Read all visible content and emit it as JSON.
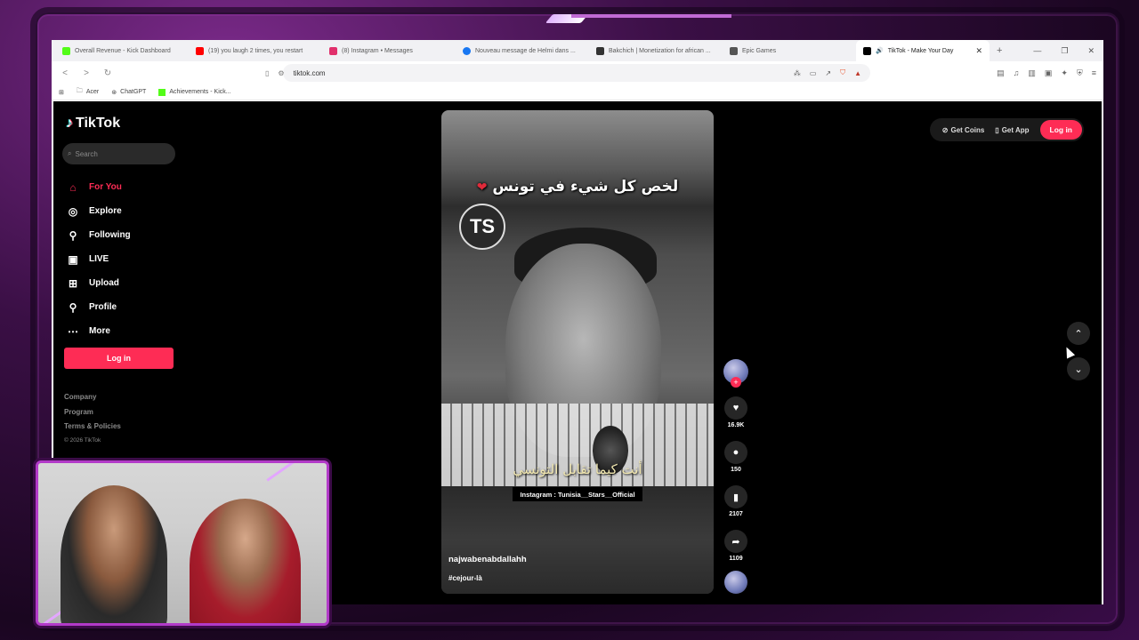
{
  "browser": {
    "tabs": [
      {
        "label": "Overall Revenue - Kick Dashboard",
        "color": "#53fc18"
      },
      {
        "label": "(19) you laugh 2 times, you restart",
        "color": "#ff0000"
      },
      {
        "label": "(8) Instagram • Messages",
        "color": "#e1306c"
      },
      {
        "label": "Nouveau message de Helmi dans ...",
        "color": "#1877f2"
      },
      {
        "label": "Bakchich | Monetization for african ...",
        "color": "#333333"
      },
      {
        "label": "Epic Games",
        "color": "#555555"
      },
      {
        "label": "TikTok - Make Your Day",
        "color": "#000000",
        "active": true
      }
    ],
    "url": "tiktok.com",
    "bookmarks": [
      "Acer",
      "ChatGPT",
      "Achievements - Kick..."
    ]
  },
  "tiktok": {
    "logo": "TikTok",
    "search_placeholder": "Search",
    "nav": [
      {
        "label": "For You",
        "icon": "home-icon",
        "glyph": "⌂",
        "active": true
      },
      {
        "label": "Explore",
        "icon": "compass-icon",
        "glyph": "◎"
      },
      {
        "label": "Following",
        "icon": "following-icon",
        "glyph": "⚲"
      },
      {
        "label": "LIVE",
        "icon": "live-icon",
        "glyph": "▣"
      },
      {
        "label": "Upload",
        "icon": "upload-icon",
        "glyph": "⊞"
      },
      {
        "label": "Profile",
        "icon": "profile-icon",
        "glyph": "⚲"
      },
      {
        "label": "More",
        "icon": "more-icon",
        "glyph": "⋯"
      }
    ],
    "login_label": "Log in",
    "footer": [
      "Company",
      "Program",
      "Terms & Policies"
    ],
    "copyright": "© 2026 TikTok",
    "get_coins": "Get Coins",
    "get_app": "Get App",
    "video": {
      "caption": "لخص كل شيء في تونس",
      "subtitle": "أنت كيما تقابل التونسي",
      "instagram": "Instagram : Tunisia__Stars__Official",
      "badge": "TS",
      "username": "najwabenabdallahh",
      "hashtag": "#cejour-là"
    },
    "actions": {
      "likes": "16.9K",
      "comments": "150",
      "saves": "2107",
      "shares": "1109"
    },
    "accent_color": "#fe2c55"
  }
}
